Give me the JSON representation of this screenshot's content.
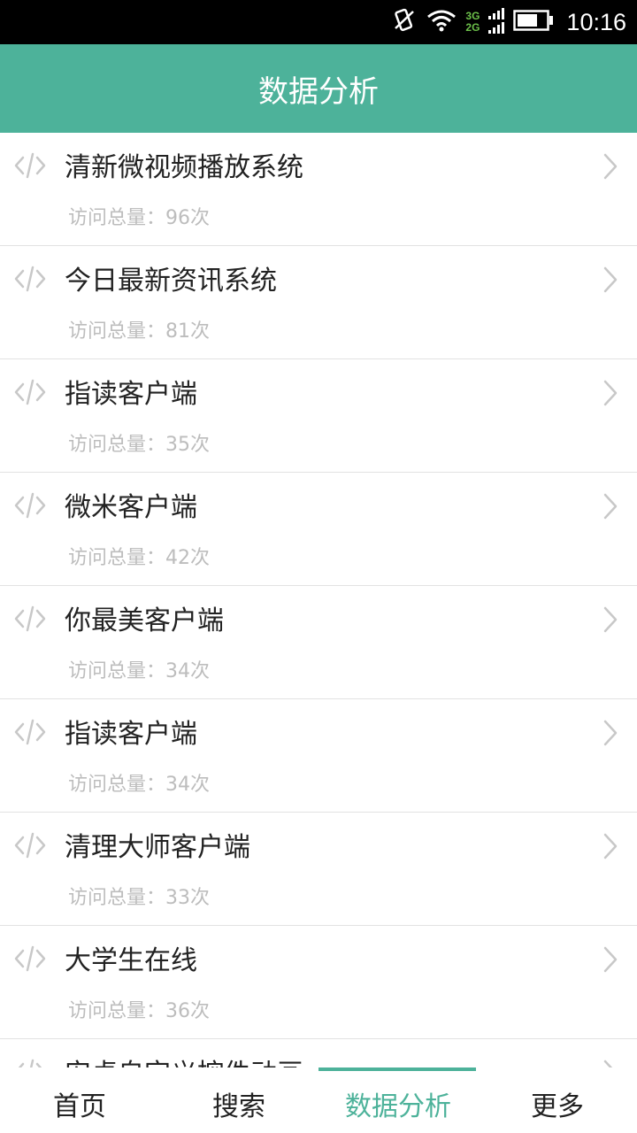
{
  "status_bar": {
    "time": "10:16",
    "network_top": "3G",
    "network_bottom": "2G",
    "icons": [
      "vibrate-icon",
      "wifi-icon",
      "signal-icon",
      "battery-icon"
    ]
  },
  "header": {
    "title": "数据分析"
  },
  "list": {
    "items": [
      {
        "title": "清新微视频播放系统",
        "visits": "访问总量：96次"
      },
      {
        "title": "今日最新资讯系统",
        "visits": "访问总量：81次"
      },
      {
        "title": "指读客户端",
        "visits": "访问总量：35次"
      },
      {
        "title": "微米客户端",
        "visits": "访问总量：42次"
      },
      {
        "title": "你最美客户端",
        "visits": "访问总量：34次"
      },
      {
        "title": "指读客户端",
        "visits": "访问总量：34次"
      },
      {
        "title": "清理大师客户端",
        "visits": "访问总量：33次"
      },
      {
        "title": "大学生在线",
        "visits": "访问总量：36次"
      },
      {
        "title": "安卓自定义控件动画",
        "visits": ""
      }
    ]
  },
  "tabbar": {
    "tabs": [
      {
        "label": "首页"
      },
      {
        "label": "搜索"
      },
      {
        "label": "数据分析"
      },
      {
        "label": "更多"
      }
    ],
    "active_index": 2
  },
  "colors": {
    "accent": "#4db29a",
    "status_bar": "#000000",
    "network_label": "#6cc04a",
    "title_text": "#222222",
    "sub_text": "#bdbdbd",
    "divider": "#e2e2e2"
  }
}
